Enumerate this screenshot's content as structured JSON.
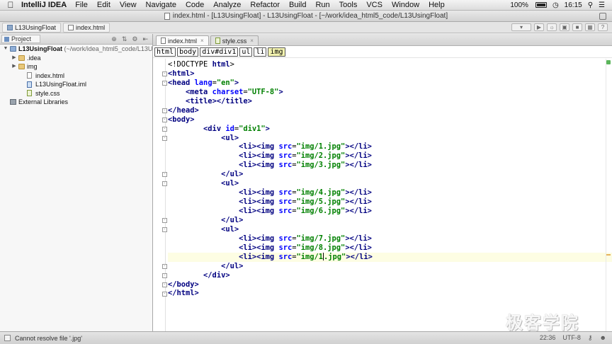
{
  "menubar": {
    "app_name": "IntelliJ IDEA",
    "menus": [
      "File",
      "Edit",
      "View",
      "Navigate",
      "Code",
      "Analyze",
      "Refactor",
      "Build",
      "Run",
      "Tools",
      "VCS",
      "Window",
      "Help"
    ],
    "battery": "100%",
    "clock": "16:15"
  },
  "window": {
    "title": "index.html - [L13UsingFloat] - L13UsingFloat - [~/work/idea_html5_code/L13UsingFloat]"
  },
  "navbar": {
    "crumbs": [
      "L13UsingFloat",
      "index.html"
    ]
  },
  "project_panel": {
    "tab_label": "Project",
    "tree": [
      {
        "label": "L13UsingFloat",
        "suffix": "(~/work/idea_html5_code/L13U",
        "type": "module",
        "indent": 0,
        "expanded": true
      },
      {
        "label": ".idea",
        "type": "folder",
        "indent": 1,
        "expanded": false
      },
      {
        "label": "img",
        "type": "folder",
        "indent": 1,
        "expanded": false
      },
      {
        "label": "index.html",
        "type": "html",
        "indent": 2
      },
      {
        "label": "L13UsingFloat.iml",
        "type": "iml",
        "indent": 2
      },
      {
        "label": "style.css",
        "type": "css",
        "indent": 2
      },
      {
        "label": "External Libraries",
        "type": "lib",
        "indent": 0
      }
    ]
  },
  "editor": {
    "tabs": [
      {
        "label": "index.html",
        "active": true
      },
      {
        "label": "style.css",
        "active": false
      }
    ],
    "tag_breadcrumbs": [
      "html",
      "body",
      "div#div1",
      "ul",
      "li",
      "img"
    ],
    "lines": [
      "<!DOCTYPE html>",
      "<html>",
      "<head lang=\"en\">",
      "    <meta charset=\"UTF-8\">",
      "    <title></title>",
      "</head>",
      "<body>",
      "        <div id=\"div1\">",
      "            <ul>",
      "                <li><img src=\"img/1.jpg\"></li>",
      "                <li><img src=\"img/2.jpg\"></li>",
      "                <li><img src=\"img/3.jpg\"></li>",
      "            </ul>",
      "            <ul>",
      "                <li><img src=\"img/4.jpg\"></li>",
      "                <li><img src=\"img/5.jpg\"></li>",
      "                <li><img src=\"img/6.jpg\"></li>",
      "            </ul>",
      "            <ul>",
      "                <li><img src=\"img/7.jpg\"></li>",
      "                <li><img src=\"img/8.jpg\"></li>",
      "                <li><img src=\"img/1.jpg\"></li>",
      "            </ul>",
      "        </div>",
      "</body>",
      "</html>"
    ],
    "current_line": 21
  },
  "statusbar": {
    "message": "Cannot resolve file '.jpg'",
    "position": "22:36",
    "encoding": "UTF-8"
  },
  "watermark": "极客学院"
}
